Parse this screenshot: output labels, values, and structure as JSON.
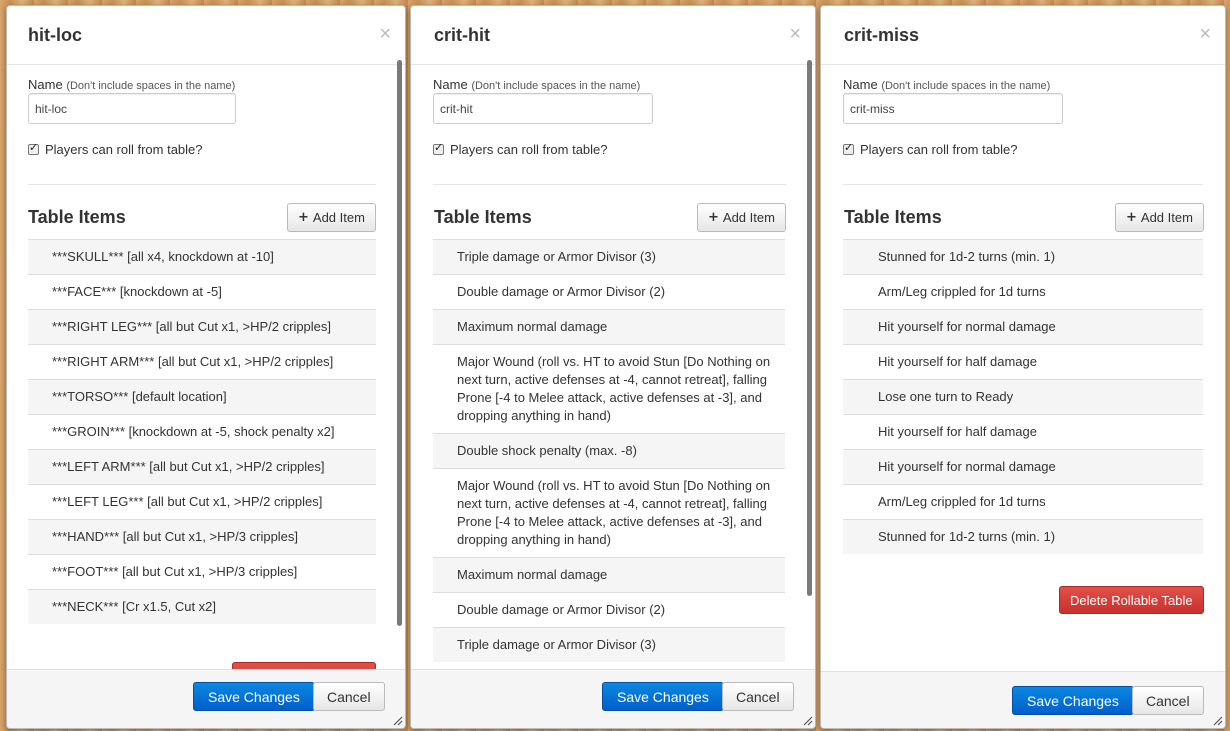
{
  "dialogs": {
    "hitloc": {
      "title": "hit-loc",
      "close_glyph": "×",
      "name_label": "Name",
      "name_hint": "(Don't include spaces in the name)",
      "name_value": "hit-loc",
      "checkbox_label": "Players can roll from table?",
      "checkbox_checked": true,
      "section_title": "Table Items",
      "add_item_label": "Add Item",
      "items": [
        "***SKULL*** [all x4, knockdown at -10]",
        "***FACE*** [knockdown at -5]",
        "***RIGHT LEG*** [all but Cut x1, >HP/2 cripples]",
        "***RIGHT ARM*** [all but Cut x1, >HP/2 cripples]",
        "***TORSO*** [default location]",
        "***GROIN*** [knockdown at -5, shock penalty x2]",
        "***LEFT ARM*** [all but Cut x1, >HP/2 cripples]",
        "***LEFT LEG*** [all but Cut x1, >HP/2 cripples]",
        "***HAND*** [all but Cut x1, >HP/3 cripples]",
        "***FOOT*** [all but Cut x1, >HP/3 cripples]",
        "***NECK*** [Cr x1.5, Cut x2]"
      ],
      "save_label": "Save Changes",
      "cancel_label": "Cancel"
    },
    "crithit": {
      "title": "crit-hit",
      "close_glyph": "×",
      "name_label": "Name",
      "name_hint": "(Don't include spaces in the name)",
      "name_value": "crit-hit",
      "checkbox_label": "Players can roll from table?",
      "checkbox_checked": true,
      "section_title": "Table Items",
      "add_item_label": "Add Item",
      "items": [
        "Triple damage or Armor Divisor (3)",
        "Double damage or Armor Divisor (2)",
        "Maximum normal damage",
        "Major Wound (roll vs. HT to avoid Stun [Do Nothing on next turn, active defenses at -4, cannot retreat], falling Prone [-4 to Melee attack, active defenses at -3], and dropping anything in hand)",
        "Double shock penalty (max. -8)",
        "Major Wound (roll vs. HT to avoid Stun [Do Nothing on next turn, active defenses at -4, cannot retreat], falling Prone [-4 to Melee attack, active defenses at -3], and dropping anything in hand)",
        "Maximum normal damage",
        "Double damage or Armor Divisor (2)",
        "Triple damage or Armor Divisor (3)"
      ],
      "save_label": "Save Changes",
      "cancel_label": "Cancel"
    },
    "critmiss": {
      "title": "crit-miss",
      "close_glyph": "×",
      "name_label": "Name",
      "name_hint": "(Don't include spaces in the name)",
      "name_value": "crit-miss",
      "checkbox_label": "Players can roll from table?",
      "checkbox_checked": true,
      "section_title": "Table Items",
      "add_item_label": "Add Item",
      "items": [
        "Stunned for 1d-2 turns (min. 1)",
        "Arm/Leg crippled for 1d turns",
        "Hit yourself for normal damage",
        "Hit yourself for half damage",
        "Lose one turn to Ready",
        "Hit yourself for half damage",
        "Hit yourself for normal damage",
        "Arm/Leg crippled for 1d turns",
        "Stunned for 1d-2 turns (min. 1)"
      ],
      "delete_label": "Delete Rollable Table",
      "save_label": "Save Changes",
      "cancel_label": "Cancel"
    }
  }
}
